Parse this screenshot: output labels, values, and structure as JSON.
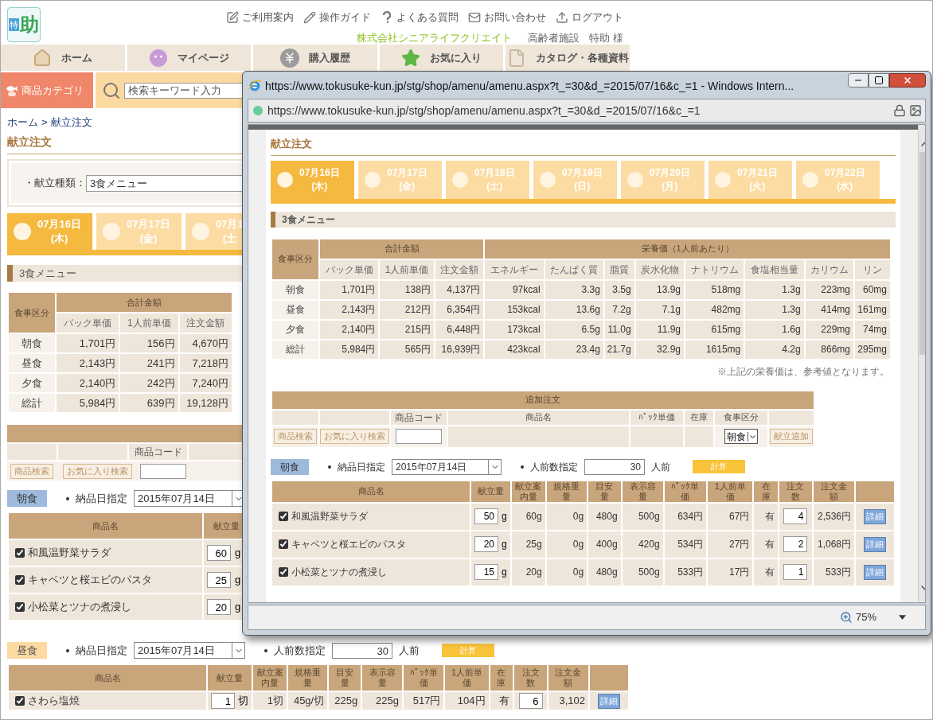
{
  "page": {
    "logo": {
      "mark": "特",
      "text": "助"
    },
    "top_links": [
      {
        "label": "ご利用案内",
        "kind": "info"
      },
      {
        "label": "操作ガイド",
        "kind": "guide"
      },
      {
        "label": "よくある質問",
        "kind": "faq"
      },
      {
        "label": "お問い合わせ",
        "kind": "contact"
      },
      {
        "label": "ログアウト",
        "kind": "logout"
      }
    ],
    "company": "株式会社シニアライフクリエイト",
    "facility": "高齢者施設",
    "user": "特助 様",
    "nav": [
      {
        "label": "ホーム",
        "kind": "home"
      },
      {
        "label": "マイページ",
        "kind": "mypage"
      },
      {
        "label": "購入履歴",
        "kind": "history"
      },
      {
        "label": "お気に入り",
        "kind": "favorite"
      },
      {
        "label": "カタログ・各種資料",
        "kind": "catalog"
      }
    ],
    "category_button": "商品カテゴリ",
    "search": {
      "placeholder": "検索キーワード入力"
    },
    "breadcrumb": {
      "home": "ホーム",
      "separator": ">",
      "current": "献立注文"
    },
    "heading": "献立注文",
    "menu_type": {
      "label": "・献立種類：",
      "value": "3食メニュー"
    },
    "day_tabs": [
      {
        "date": "07月16日",
        "weekday": "(木)",
        "selected": true
      },
      {
        "date": "07月17日",
        "weekday": "(金)",
        "selected": false
      },
      {
        "date": "07月1",
        "weekday": "(土",
        "selected": false
      }
    ],
    "section_title": "3食メニュー",
    "summary": {
      "row_header": "食事区分",
      "groups": [
        {
          "label": "合計金額",
          "columns": [
            "パック単価",
            "1人前単価",
            "注文金額"
          ]
        }
      ],
      "rows": [
        {
          "label": "朝食",
          "cells": [
            "1,701円",
            "156円",
            "4,670円"
          ]
        },
        {
          "label": "昼食",
          "cells": [
            "2,143円",
            "241円",
            "7,218円"
          ]
        },
        {
          "label": "夕食",
          "cells": [
            "2,140円",
            "242円",
            "7,240円"
          ]
        },
        {
          "label": "総計",
          "cells": [
            "5,984円",
            "639円",
            "19,128円"
          ]
        }
      ]
    },
    "add_order": {
      "code_label": "商品コード",
      "search_button": "商品検索",
      "favorite_button": "お気に入り検索"
    },
    "meals": [
      {
        "name": "朝食",
        "kind": "breakfast",
        "date_label": "納品日指定",
        "date": "2015年07月14日",
        "columns": [
          "商品名",
          "献立量"
        ],
        "items": [
          {
            "name": "和風温野菜サラダ",
            "checked": true,
            "amount": "60",
            "unit": "g"
          },
          {
            "name": "キャベツと桜エビのパスタ",
            "checked": true,
            "amount": "25",
            "unit": "g"
          },
          {
            "name": "小松菜とツナの煮浸し",
            "checked": true,
            "amount": "20",
            "unit": "g"
          }
        ]
      },
      {
        "name": "昼食",
        "kind": "lunch",
        "date_label": "納品日指定",
        "date": "2015年07月14日",
        "servings_label": "人前数指定",
        "servings": "30",
        "servings_unit": "人前",
        "calc_button": "計算",
        "columns": [
          "商品名",
          "献立量",
          "献立案内量",
          "規格重量",
          "目安量",
          "表示容量",
          "ﾊﾟｯｸ単価",
          "1人前単価",
          "在庫",
          "注文数",
          "注文金額"
        ],
        "items": [
          {
            "name": "さわら塩焼",
            "checked": true,
            "amount": "1",
            "unit": "切",
            "cells": [
              "1切",
              "45g/切",
              "225g",
              "225g",
              "517円",
              "104円",
              "有"
            ],
            "qty": "6",
            "total": "3,102",
            "detail": "詳細"
          }
        ]
      }
    ]
  },
  "popup": {
    "title": "https://www.tokusuke-kun.jp/stg/shop/amenu/amenu.aspx?t_=30&d_=2015/07/16&c_=1 - Windows Intern...",
    "address": "https://www.tokusuke-kun.jp/stg/shop/amenu/amenu.aspx?t_=30&d_=2015/07/16&c_=1",
    "heading": "献立注文",
    "day_tabs": [
      {
        "date": "07月16日",
        "weekday": "(木)",
        "selected": true
      },
      {
        "date": "07月17日",
        "weekday": "(金)",
        "selected": false
      },
      {
        "date": "07月18日",
        "weekday": "(土)",
        "selected": false
      },
      {
        "date": "07月19日",
        "weekday": "(日)",
        "selected": false
      },
      {
        "date": "07月20日",
        "weekday": "(月)",
        "selected": false
      },
      {
        "date": "07月21日",
        "weekday": "(火)",
        "selected": false
      },
      {
        "date": "07月22日",
        "weekday": "(水)",
        "selected": false
      }
    ],
    "section_title": "3食メニュー",
    "nutrition": {
      "row_header": "食事区分",
      "groups": [
        {
          "label": "合計金額",
          "columns": [
            "パック単価",
            "1人前単価",
            "注文金額"
          ]
        },
        {
          "label": "栄養価（1人前あたり）",
          "columns": [
            "エネルギー",
            "たんぱく質",
            "脂質",
            "炭水化物",
            "ナトリウム",
            "食塩相当量",
            "カリウム",
            "リン"
          ]
        }
      ],
      "rows": [
        {
          "label": "朝食",
          "cells": [
            "1,701円",
            "138円",
            "4,137円",
            "97kcal",
            "3.3g",
            "3.5g",
            "13.9g",
            "518mg",
            "1.3g",
            "223mg",
            "60mg"
          ]
        },
        {
          "label": "昼食",
          "cells": [
            "2,143円",
            "212円",
            "6,354円",
            "153kcal",
            "13.6g",
            "7.2g",
            "7.1g",
            "482mg",
            "1.3g",
            "414mg",
            "161mg"
          ]
        },
        {
          "label": "夕食",
          "cells": [
            "2,140円",
            "215円",
            "6,448円",
            "173kcal",
            "6.5g",
            "11.0g",
            "11.9g",
            "615mg",
            "1.6g",
            "229mg",
            "74mg"
          ]
        },
        {
          "label": "総計",
          "cells": [
            "5,984円",
            "565円",
            "16,939円",
            "423kcal",
            "23.4g",
            "21.7g",
            "32.9g",
            "1615mg",
            "4.2g",
            "866mg",
            "295mg"
          ]
        }
      ]
    },
    "note": "※上記の栄養価は、参考値となります。",
    "add_order": {
      "title": "追加注文",
      "code_label": "商品コード",
      "name_label": "商品名",
      "price_label": "ﾊﾟｯｸ単価",
      "stock_label": "在庫",
      "meal_label": "食事区分",
      "search_button": "商品検索",
      "favorite_button": "お気に入り検索",
      "meal_value": "朝食",
      "add_button": "献立追加"
    },
    "meal": {
      "name": "朝食",
      "kind": "breakfast",
      "date_label": "納品日指定",
      "date": "2015年07月14日",
      "servings_label": "人前数指定",
      "servings": "30",
      "servings_unit": "人前",
      "calc_button": "計算",
      "columns": [
        "商品名",
        "献立量",
        "献立案内量",
        "規格重量",
        "目安量",
        "表示容量",
        "ﾊﾟｯｸ単価",
        "1人前単価",
        "在庫",
        "注文数",
        "注文金額"
      ],
      "items": [
        {
          "name": "和風温野菜サラダ",
          "checked": true,
          "amount": "50",
          "unit": "g",
          "cells": [
            "60g",
            "0g",
            "480g",
            "500g",
            "634円",
            "67円",
            "有"
          ],
          "qty": "4",
          "total": "2,536円",
          "detail": "詳細"
        },
        {
          "name": "キャベツと桜エビのパスタ",
          "checked": true,
          "amount": "20",
          "unit": "g",
          "cells": [
            "25g",
            "0g",
            "400g",
            "420g",
            "534円",
            "27円",
            "有"
          ],
          "qty": "2",
          "total": "1,068円",
          "detail": "詳細"
        },
        {
          "name": "小松菜とツナの煮浸し",
          "checked": true,
          "amount": "15",
          "unit": "g",
          "cells": [
            "20g",
            "0g",
            "480g",
            "500g",
            "533円",
            "17円",
            "有"
          ],
          "qty": "1",
          "total": "533円",
          "detail": "詳細"
        }
      ]
    },
    "zoom": "75%"
  }
}
